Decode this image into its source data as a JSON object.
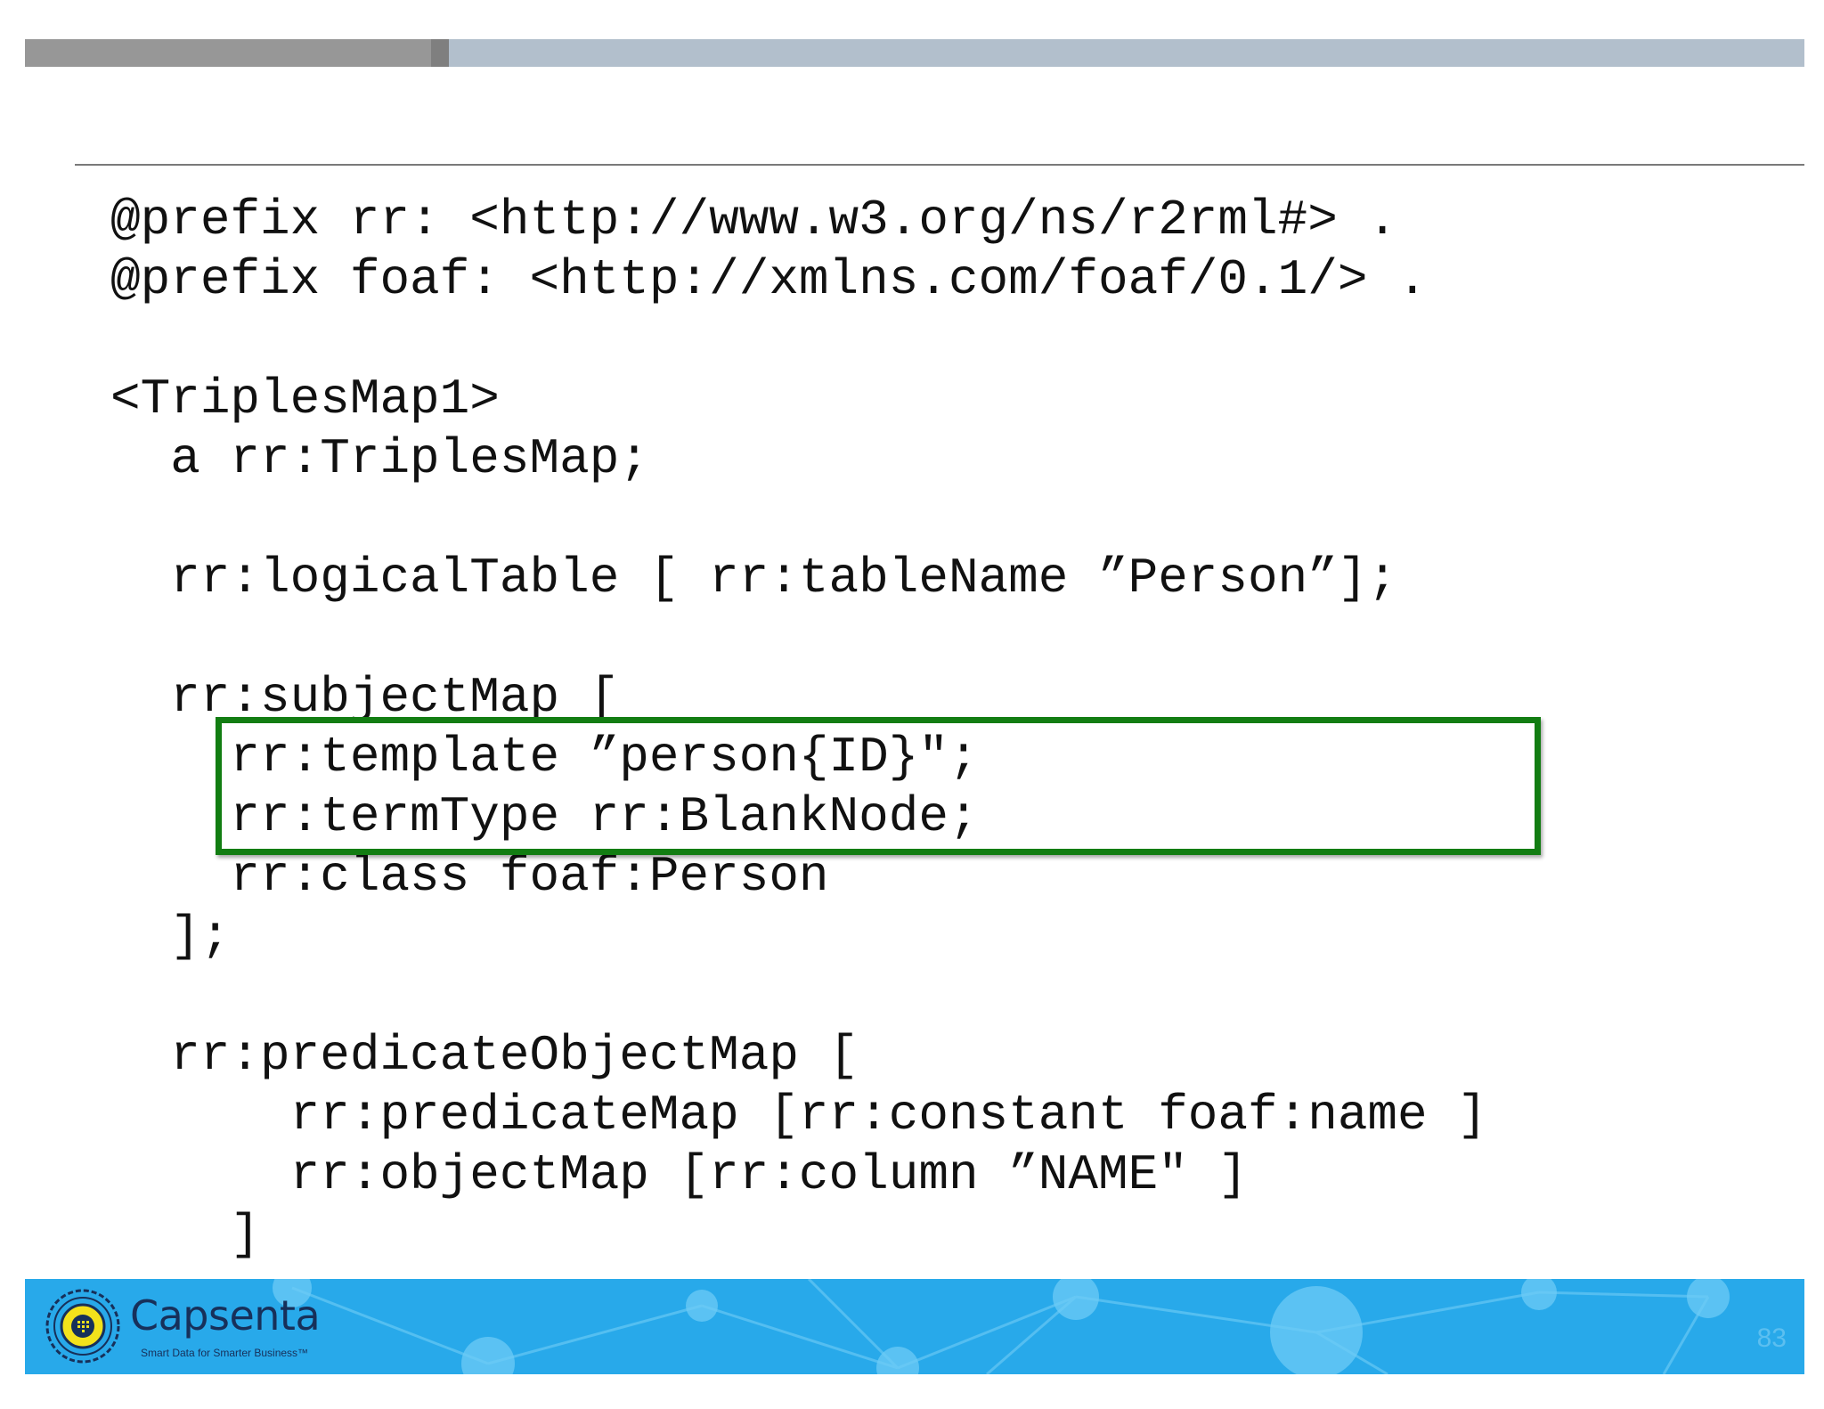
{
  "code_lines": [
    "@prefix rr: <http://www.w3.org/ns/r2rml#> .",
    "@prefix foaf: <http://xmlns.com/foaf/0.1/> .",
    "",
    "<TriplesMap1>",
    "  a rr:TriplesMap;",
    "",
    "  rr:logicalTable [ rr:tableName ”Person”];",
    "",
    "  rr:subjectMap [",
    "    rr:template ”person{ID}\";",
    "    rr:termType rr:BlankNode;",
    "    rr:class foaf:Person",
    "  ];",
    "",
    "  rr:predicateObjectMap [",
    "      rr:predicateMap [rr:constant foaf:name ]",
    "      rr:objectMap [rr:column ”NAME\" ]",
    "    ]",
    "    ."
  ],
  "footer": {
    "brand": "Capsenta",
    "tagline": "Smart Data for Smarter Business™",
    "page_number": "83"
  },
  "colors": {
    "highlight_border": "#127d12",
    "footer_background": "#28a9ea",
    "top_bar": "#b2bfcc"
  }
}
